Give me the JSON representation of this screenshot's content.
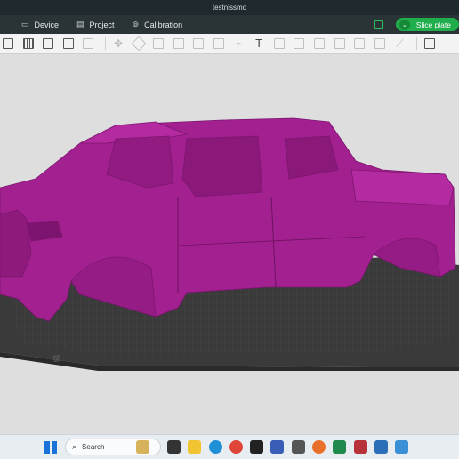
{
  "window": {
    "title": "testnissmo"
  },
  "menu": {
    "items": [
      {
        "label": "Device",
        "icon": "monitor-icon"
      },
      {
        "label": "Project",
        "icon": "project-icon"
      },
      {
        "label": "Calibration",
        "icon": "calibration-icon"
      }
    ],
    "slice_label": "Slice plate"
  },
  "toolbar": {
    "tools": [
      "add-icon",
      "grid-icon",
      "edit-icon",
      "plate-icon",
      "layers-icon",
      "move-icon",
      "rotate-icon",
      "scale-icon",
      "cut-icon",
      "split-icon",
      "support-icon",
      "paint-icon",
      "text-icon",
      "measure-icon",
      "assembly-icon",
      "boolean-icon",
      "emboss-icon",
      "seam-icon",
      "paste-icon",
      "brim-icon",
      "view-icon"
    ]
  },
  "model": {
    "color": "#a3208f",
    "plate_color": "#3d3d3d",
    "grid_color": "#4a4a4a"
  },
  "taskbar": {
    "search_placeholder": "Search",
    "apps": [
      "widgets-icon",
      "file-explorer-icon",
      "edge-icon",
      "chrome-icon",
      "bambu-icon",
      "app-icon",
      "calculator-icon",
      "firefox-icon",
      "excel-icon",
      "photos-icon",
      "store-icon",
      "photos2-icon"
    ]
  }
}
